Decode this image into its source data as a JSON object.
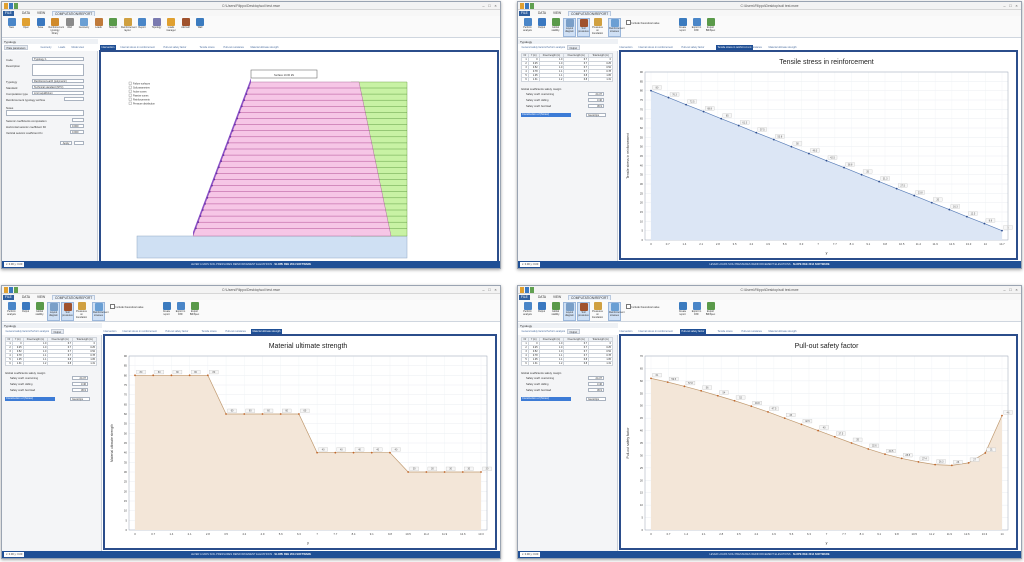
{
  "app": {
    "title": "C:\\Users\\Filippo\\Desktop\\soil test.mwe",
    "menu": [
      "FILE",
      "DATA",
      "VIEW",
      "COMPUTATION/REPORT"
    ],
    "status_center": "LEVER LOADS   SOIL PRESSURES   REINFORCEMENT ELEVATIONS",
    "status_brand": "SLOPE REE 2014 SOFTWARE",
    "status_left": "x: 0.00 y: 0.00"
  },
  "ribbon_model": {
    "buttons": [
      "New",
      "Open",
      "Save",
      "Reinforcement typology library",
      "Wall",
      "Geometry",
      "Loads",
      "Seismic",
      "Reinforcement layout",
      "Report",
      "Topology",
      "Loads manager",
      "Add soil",
      "Wall"
    ],
    "groups": [
      "File",
      "Archive",
      "Computation",
      "Reinforcement",
      "Stratigraphy",
      "Topology"
    ]
  },
  "ribbon_results": {
    "buttons": [
      "Perform analysis",
      "Output",
      "Global stability",
      "Layout diagram",
      "Soil pressures",
      "Pressures on foundation",
      "Reinforcement stresses",
      "Create report",
      "Export in DXF",
      "Export Bill/Spec"
    ],
    "include_label": "Include theoretical value"
  },
  "tree_label": "Typology",
  "win1": {
    "tabs": [
      "Plate parameters",
      "Geometry",
      "Loads",
      "Model view"
    ],
    "view_tabs": [
      "Intersection",
      "Internal stress in reinforcement",
      "Pull-out safety factor",
      "Tensile stress",
      "Pull-out resistance",
      "Material ultimate strength"
    ],
    "panel": {
      "code_label": "Code",
      "code_value": "Typology 1",
      "desc_label": "Description",
      "typology_label": "Typology",
      "typology_value": "Reinforced earth (polymeric)",
      "standard_label": "Standard",
      "standard_value": "Technical standard (NTC)",
      "computation_label": "Computation type",
      "computation_value": "Limit equilibrium",
      "archive_label": "Reinforcement typology archive",
      "notes_label": "Notes",
      "seismic_label": "Seismic coefficients computation",
      "kh_label": "Horizontal seismic coefficient Kh",
      "kh_value": "0.000",
      "kv_label": "Vertical seismic coefficient Kv",
      "kv_value": "0.000",
      "apply_label": "Apply"
    },
    "diagram": {
      "top_label": "Surface 10.00 kN",
      "legend": [
        "Failure surfaces",
        "Soil parameters",
        "Active zones",
        "Passive zones",
        "Reinforcements",
        "Pressure distribution"
      ]
    }
  },
  "result_panel": {
    "sub_tabs": [
      "General safety factors",
      "Perform analysis",
      "Output"
    ],
    "table_headers": [
      "Nr",
      "Y (m)",
      "Fixed length (m)",
      "Fixed length (m)",
      "Total length (m)"
    ],
    "table_rows": [
      [
        "1",
        "0",
        "1.0",
        "6.7",
        "0"
      ],
      [
        "2",
        "0.25",
        "1.0",
        "6.7",
        "0.25"
      ],
      [
        "3",
        "0.52",
        "1.0",
        "6.7",
        "0.52"
      ],
      [
        "4",
        "0.78",
        "1.1",
        "6.7",
        "0.78"
      ],
      [
        "5",
        "1.05",
        "1.1",
        "6.8",
        "1.05"
      ],
      [
        "6",
        "1.31",
        "1.2",
        "6.8",
        "1.31"
      ]
    ],
    "section_label": "Global coefficients safety margin",
    "coef": [
      {
        "label": "Safety coeff. overturning",
        "value": "24.37"
      },
      {
        "label": "Safety coeff. sliding",
        "value": "3.46"
      },
      {
        "label": "Safety coeff. bed load",
        "value": "36.9"
      }
    ],
    "select_label": "Construction of (Sintex)",
    "select_value": "Geostrips"
  },
  "chart_data": [
    {
      "type": "area",
      "title": "Tensile stress in reinforcement",
      "xlabel": "y",
      "ylabel": "Tensile stress in reinforcement",
      "x": [
        0,
        0.7,
        1.4,
        2.1,
        2.8,
        3.5,
        4.2,
        4.9,
        5.6,
        6.3,
        7.0,
        7.7,
        8.4,
        9.1,
        9.8,
        10.5,
        11.2,
        11.9,
        12.6,
        13.3,
        14.0,
        14.7,
        15.4,
        16.1
      ],
      "values": [
        80,
        76.3,
        72.5,
        68.8,
        65,
        61.3,
        57.5,
        53.8,
        50,
        46.3,
        42.5,
        38.8,
        35,
        31.3,
        27.5,
        23.8,
        20,
        16.3,
        12.5,
        8.8,
        5
      ],
      "ylim": [
        0,
        90
      ],
      "xticks": [
        "0",
        "0.7",
        "1.4",
        "2.1",
        "2.8",
        "3.5",
        "4.2",
        "4.9",
        "5.6",
        "6.3",
        "7",
        "7.7",
        "8.4",
        "9.1",
        "9.8",
        "10.5",
        "11.2",
        "11.9",
        "12.6",
        "13.3",
        "14",
        "14.7"
      ],
      "yticks": [
        "0",
        "5",
        "10",
        "15",
        "20",
        "25",
        "30",
        "35",
        "40",
        "45",
        "50",
        "55",
        "60",
        "65",
        "70",
        "75",
        "80",
        "85",
        "90"
      ],
      "fill": "#dce6f5",
      "stroke": "#5b7fb8",
      "active_tab": "Tensile stress in reinforcement"
    },
    {
      "type": "area",
      "title": "Material ultimate strength",
      "xlabel": "y",
      "ylabel": "Material ultimate strength",
      "values": [
        80,
        80,
        80,
        80,
        80,
        60,
        60,
        60,
        60,
        60,
        40,
        40,
        40,
        40,
        40,
        30,
        30,
        30,
        30,
        30
      ],
      "ylim": [
        0,
        90
      ],
      "xticks": [
        "0",
        "0.7",
        "1.4",
        "2.1",
        "2.8",
        "3.5",
        "4.2",
        "4.9",
        "5.6",
        "6.3",
        "7",
        "7.7",
        "8.4",
        "9.1",
        "9.8",
        "10.5",
        "11.2",
        "11.9",
        "12.6",
        "13.3"
      ],
      "yticks": [
        "0",
        "5",
        "10",
        "15",
        "20",
        "25",
        "30",
        "35",
        "40",
        "45",
        "50",
        "55",
        "60",
        "65",
        "70",
        "75",
        "80",
        "85",
        "90"
      ],
      "fill": "#f3e6d8",
      "stroke": "#c09a70",
      "active_tab": "Material ultimate strength"
    },
    {
      "type": "area",
      "title": "Pull-out safety factor",
      "xlabel": "y",
      "ylabel": "Pull-out safety factor",
      "values": [
        61,
        59.5,
        57.8,
        56,
        54,
        52,
        49.8,
        47.5,
        45,
        42.5,
        40,
        37.5,
        35,
        32.6,
        30.5,
        28.8,
        27.4,
        26.3,
        26,
        27,
        31,
        46
      ],
      "ylim": [
        0,
        70
      ],
      "xticks": [
        "0",
        "0.7",
        "1.4",
        "2.1",
        "2.8",
        "3.5",
        "4.2",
        "4.9",
        "5.6",
        "6.3",
        "7",
        "7.7",
        "8.4",
        "9.1",
        "9.8",
        "10.5",
        "11.2",
        "11.9",
        "12.6",
        "13.3",
        "14"
      ],
      "yticks": [
        "0",
        "5",
        "10",
        "15",
        "20",
        "25",
        "30",
        "35",
        "40",
        "45",
        "50",
        "55",
        "60",
        "65",
        "70"
      ],
      "fill": "#f3e6d8",
      "stroke": "#c09a70",
      "active_tab": "Pull-out safety factor"
    }
  ]
}
